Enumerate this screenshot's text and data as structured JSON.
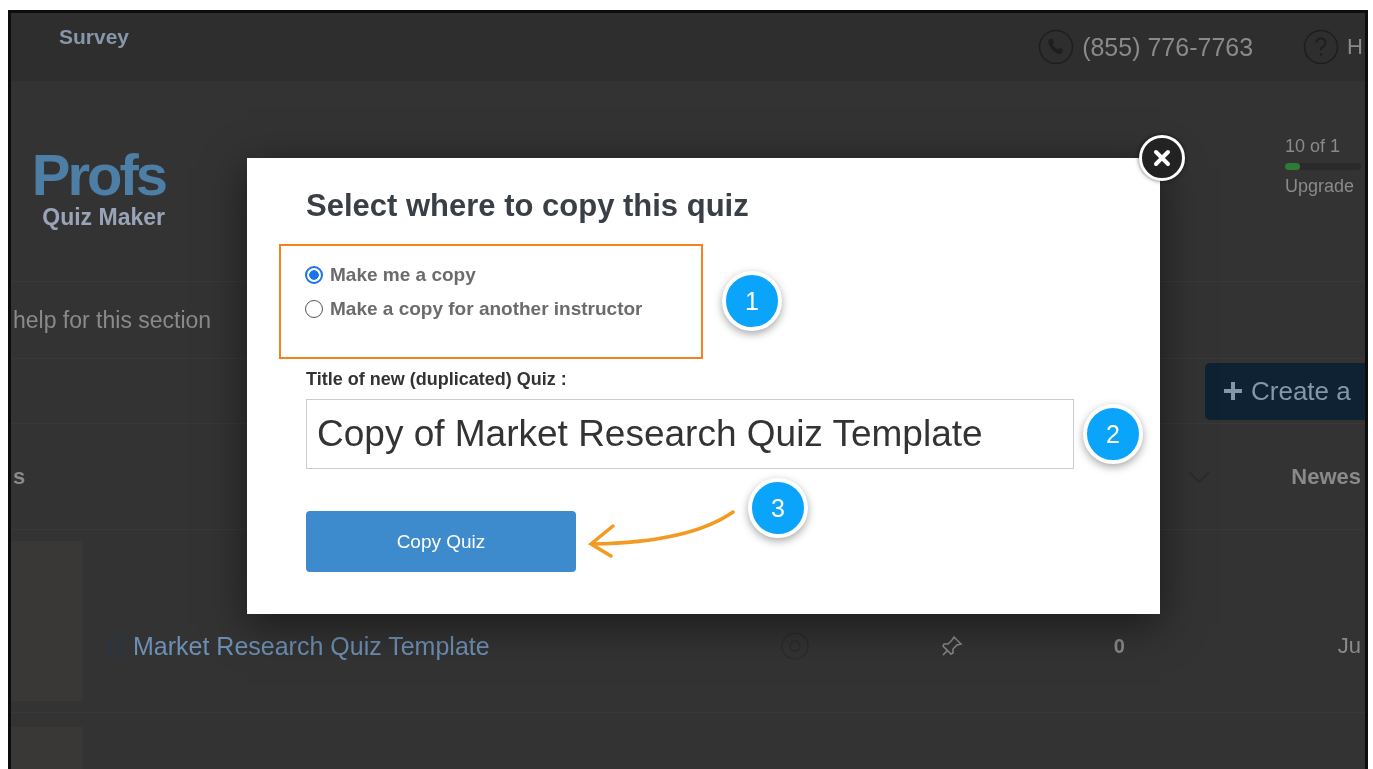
{
  "top_bar": {
    "nav_item": "Survey",
    "phone": "(855) 776-7763",
    "help": "H"
  },
  "header": {
    "logo": "Profs",
    "product": "Quiz Maker",
    "usage": "10 of 1",
    "usage_bar": {
      "level": 0.2
    },
    "upgrade": "Upgrade"
  },
  "help_link": "help for this section",
  "create_button": "Create a",
  "list_header": {
    "column_1": "s",
    "sort": "Newes"
  },
  "rows": [
    {
      "title": "Market Research Quiz Template",
      "count": "0",
      "date": "Ju"
    }
  ],
  "dialog": {
    "title": "Select where to copy this quiz",
    "options": [
      {
        "label": "Make me a copy",
        "selected": true
      },
      {
        "label": "Make a copy for another instructor",
        "selected": false
      }
    ],
    "field_label": "Title of new (duplicated) Quiz :",
    "field_value": "Copy of Market Research Quiz Template",
    "button": "Copy Quiz",
    "steps": [
      "1",
      "2",
      "3"
    ]
  }
}
